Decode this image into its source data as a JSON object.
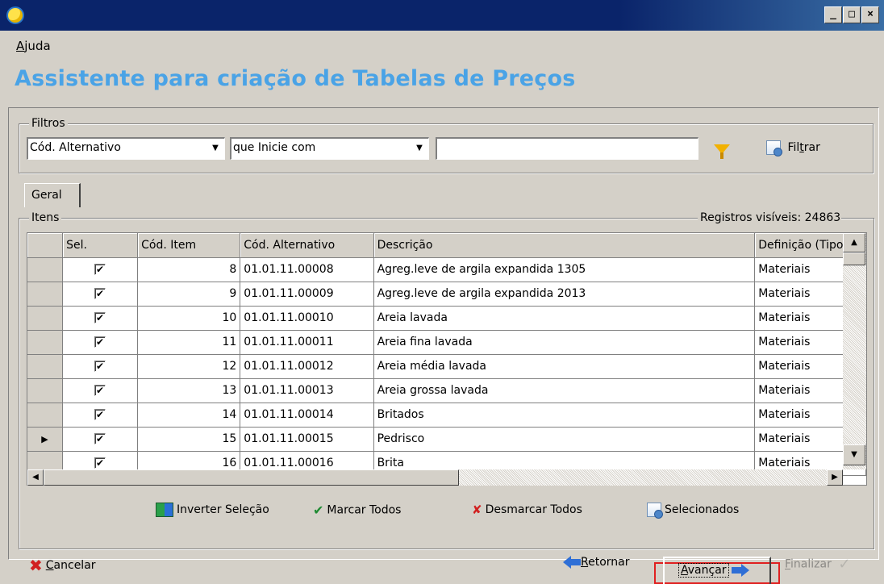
{
  "window": {
    "minimize_glyph": "_",
    "maximize_glyph": "□",
    "close_glyph": "×"
  },
  "menu": {
    "help_accel": "A",
    "help_rest": "juda"
  },
  "page_title": "Assistente para criação de Tabelas de Preços",
  "filters": {
    "legend": "Filtros",
    "field_select": "Cód. Alternativo",
    "operator_select": "que Inicie com",
    "value": "",
    "filter_button_pre": "Fil",
    "filter_button_accel": "t",
    "filter_button_post": "rar",
    "funnel_icon": "funnel-icon",
    "colors": {
      "funnel": "#f2b100"
    }
  },
  "tabs": [
    {
      "label": "Geral"
    }
  ],
  "items": {
    "legend": "Itens",
    "visible_records": "Registros visíveis: 24863",
    "columns": [
      "Sel.",
      "Cód. Item",
      "Cód. Alternativo",
      "Descrição",
      "Definição (Tipo)"
    ],
    "rows": [
      {
        "indicator": "",
        "checked": "✔",
        "item": "8",
        "alt": "01.01.11.00008",
        "desc": "Agreg.leve de argila expandida 1305",
        "type": "Materiais"
      },
      {
        "indicator": "",
        "checked": "✔",
        "item": "9",
        "alt": "01.01.11.00009",
        "desc": "Agreg.leve de argila expandida 2013",
        "type": "Materiais"
      },
      {
        "indicator": "",
        "checked": "✔",
        "item": "10",
        "alt": "01.01.11.00010",
        "desc": "Areia lavada",
        "type": "Materiais"
      },
      {
        "indicator": "",
        "checked": "✔",
        "item": "11",
        "alt": "01.01.11.00011",
        "desc": "Areia fina lavada",
        "type": "Materiais"
      },
      {
        "indicator": "",
        "checked": "✔",
        "item": "12",
        "alt": "01.01.11.00012",
        "desc": "Areia média lavada",
        "type": "Materiais"
      },
      {
        "indicator": "",
        "checked": "✔",
        "item": "13",
        "alt": "01.01.11.00013",
        "desc": "Areia grossa lavada",
        "type": "Materiais"
      },
      {
        "indicator": "",
        "checked": "✔",
        "item": "14",
        "alt": "01.01.11.00014",
        "desc": "Britados",
        "type": "Materiais"
      },
      {
        "indicator": "▶",
        "checked": "✔",
        "item": "15",
        "alt": "01.01.11.00015",
        "desc": "Pedrisco",
        "type": "Materiais"
      },
      {
        "indicator": "",
        "checked": "✔",
        "item": "16",
        "alt": "01.01.11.00016",
        "desc": "Brita",
        "type": "Materiais"
      }
    ],
    "scroll_up": "▲",
    "scroll_down": "▼",
    "scroll_left": "◀",
    "scroll_right": "▶"
  },
  "bulk_actions": {
    "invert": "Inverter Seleção",
    "mark_all": "Marcar Todos",
    "unmark_all": "Desmarcar Todos",
    "selected": "Selecionados"
  },
  "footer": {
    "cancel_accel": "C",
    "cancel_rest": "ancelar",
    "back_accel": "R",
    "back_rest": "etornar",
    "next_accel": "A",
    "next_rest": "vançar",
    "finish_accel": "F",
    "finish_rest": "inalizar"
  },
  "colors": {
    "title": "#4aa3e6",
    "titlebar": "#0a246a",
    "window_bg": "#d4d0c8",
    "highlight_frame": "#e02020"
  }
}
